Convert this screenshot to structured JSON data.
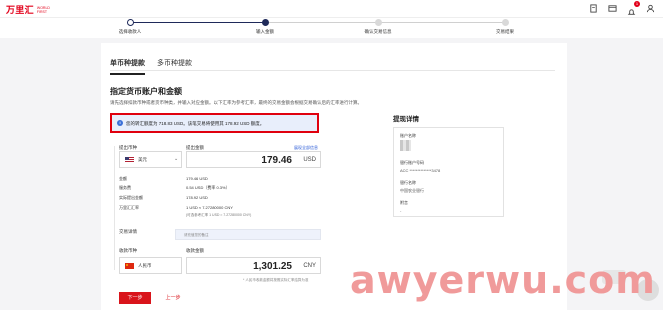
{
  "brand": {
    "name": "万里汇",
    "sub": "WORLD FIRST"
  },
  "steps": [
    {
      "label": "选择收款人",
      "state": "done"
    },
    {
      "label": "输入金额",
      "state": "active"
    },
    {
      "label": "确认交易信息",
      "state": "todo"
    },
    {
      "label": "交易结果",
      "state": "todo"
    }
  ],
  "tabs": [
    {
      "label": "单币种提款",
      "active": true
    },
    {
      "label": "多币种提款",
      "active": false
    }
  ],
  "section": {
    "title": "指定货币账户和金额",
    "desc": "请先选择扣款币种或者货币种类，并输入对应金额。以下汇率为参考汇率，最终的交易金额会根据交易确认后的汇率进行计算。"
  },
  "alert": {
    "text": "您的转汇额度为 718.83 USD。该笔交易将使用其 178.92 USD 额度。"
  },
  "debit": {
    "currency_label": "提出币种",
    "amount_label": "提出金额",
    "currency": "美元",
    "amount": "179.46",
    "unit": "USD",
    "link": "展现全部信息"
  },
  "fees": {
    "rows": [
      {
        "k": "金额",
        "v": "179.46 USD"
      },
      {
        "k": "服务费",
        "v": "0.54 USD（费率 0.3%）"
      },
      {
        "k": "实际提出金额",
        "v": "178.92 USD"
      },
      {
        "k": "万里汇汇率",
        "v": "1 USD ≈ 7.27280000 CNY"
      }
    ],
    "rate_sub": "(可选参考汇率 1 USD ≈ 7.27280000 CNY)"
  },
  "note": {
    "label": "交易详情",
    "placeholder": "请充值您的备注"
  },
  "credit": {
    "currency_label": "收款币种",
    "amount_label": "收款金额",
    "currency": "人民币",
    "amount": "1,301.25",
    "unit": "CNY",
    "hint": "* 人民币收款金额将按照实际汇率结算为准"
  },
  "buttons": {
    "next": "下一步",
    "prev": "上一步"
  },
  "detail": {
    "title": "提现详情",
    "rows": [
      {
        "k": "账户名称",
        "v": ""
      },
      {
        "k": "银行账户号码",
        "v": "ACC **************3478"
      },
      {
        "k": "银行名称",
        "v": "中国农业银行"
      },
      {
        "k": "附言",
        "v": "-"
      }
    ]
  },
  "watermark": "awyerwu.com",
  "colors": {
    "accent": "#e2001a",
    "primary": "#1f2a5a",
    "link": "#2a5bd7"
  }
}
